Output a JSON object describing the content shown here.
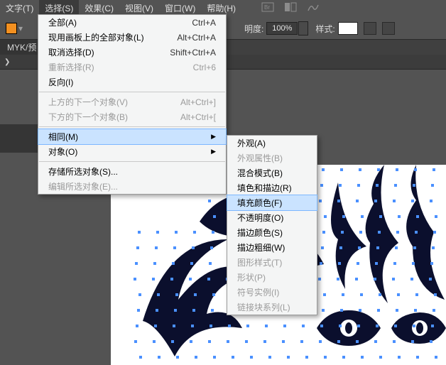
{
  "menubar": {
    "items": [
      {
        "label": "文字(T)"
      },
      {
        "label": "选择(S)"
      },
      {
        "label": "效果(C)"
      },
      {
        "label": "视图(V)"
      },
      {
        "label": "窗口(W)"
      },
      {
        "label": "帮助(H)"
      }
    ]
  },
  "toolbar": {
    "opacity_label": "明度:",
    "opacity_value": "100%",
    "style_label": "样式:"
  },
  "tabrow": {
    "tab_label": "MYK/预"
  },
  "zoombar": {
    "arrow": "❯"
  },
  "dd1": {
    "rows": [
      {
        "label": "全部(A)",
        "shortcut": "Ctrl+A"
      },
      {
        "label": "现用画板上的全部对象(L)",
        "shortcut": "Alt+Ctrl+A"
      },
      {
        "label": "取消选择(D)",
        "shortcut": "Shift+Ctrl+A"
      },
      {
        "label": "重新选择(R)",
        "shortcut": "Ctrl+6",
        "disabled": true
      },
      {
        "label": "反向(I)"
      },
      {
        "sep": true
      },
      {
        "label": "上方的下一个对象(V)",
        "shortcut": "Alt+Ctrl+]",
        "disabled": true
      },
      {
        "label": "下方的下一个对象(B)",
        "shortcut": "Alt+Ctrl+[",
        "disabled": true
      },
      {
        "sep": true
      },
      {
        "label": "相同(M)",
        "sub": true,
        "highlight": true
      },
      {
        "label": "对象(O)",
        "sub": true
      },
      {
        "sep": true
      },
      {
        "label": "存储所选对象(S)..."
      },
      {
        "label": "编辑所选对象(E)...",
        "disabled": true
      }
    ]
  },
  "dd2": {
    "rows": [
      {
        "label": "外观(A)"
      },
      {
        "label": "外观属性(B)",
        "disabled": true
      },
      {
        "label": "混合模式(B)"
      },
      {
        "label": "填色和描边(R)"
      },
      {
        "label": "填充颜色(F)",
        "highlight": true
      },
      {
        "label": "不透明度(O)"
      },
      {
        "label": "描边颜色(S)"
      },
      {
        "label": "描边粗细(W)"
      },
      {
        "label": "图形样式(T)",
        "disabled": true
      },
      {
        "label": "形状(P)",
        "disabled": true
      },
      {
        "label": "符号实例(I)",
        "disabled": true
      },
      {
        "label": "链接块系列(L)",
        "disabled": true
      }
    ]
  }
}
